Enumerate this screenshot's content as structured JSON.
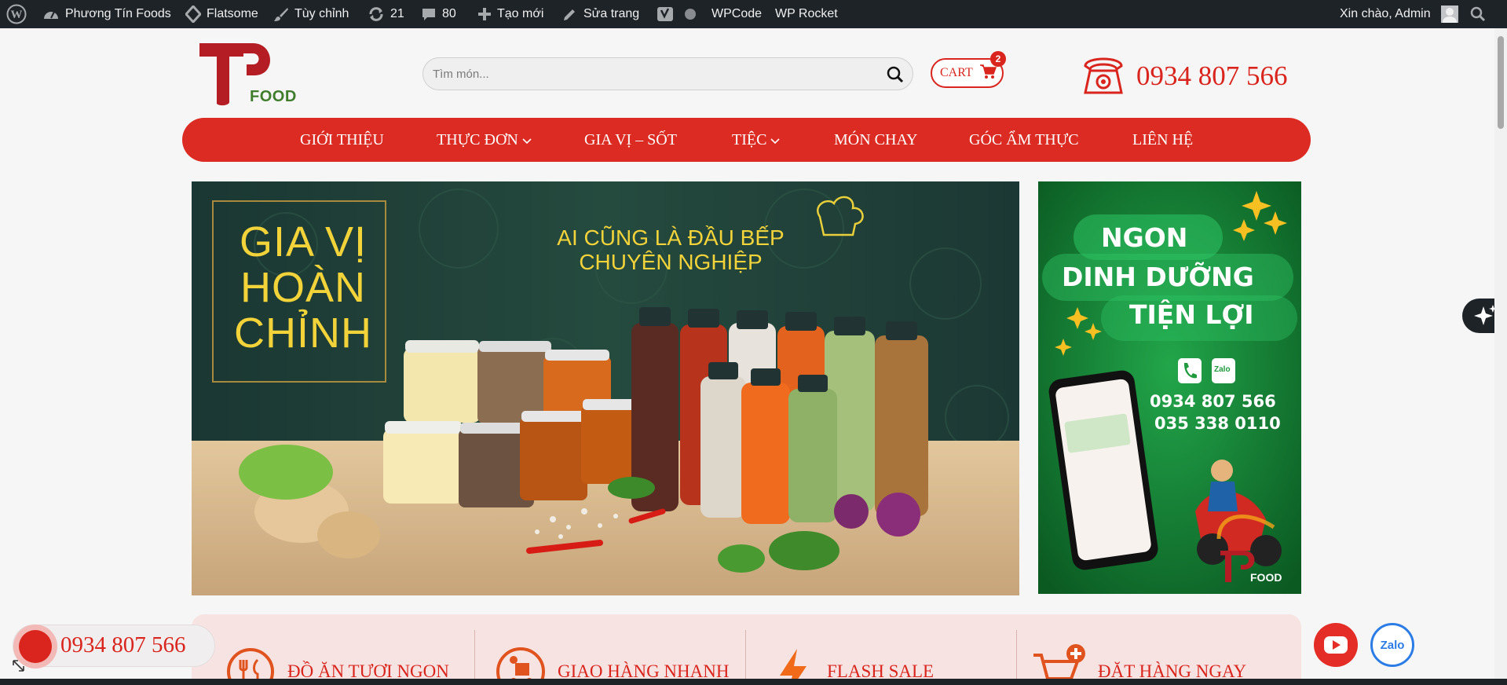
{
  "admin_bar": {
    "site_name": "Phương Tín Foods",
    "theme": "Flatsome",
    "customize": "Tùy chỉnh",
    "updates_count": "21",
    "comments_count": "80",
    "new_label": "Tạo mới",
    "edit_label": "Sửa trang",
    "wpcode": "WPCode",
    "wprocket": "WP Rocket",
    "greeting": "Xin chào, Admin"
  },
  "header": {
    "logo_text": "FOOD",
    "search_placeholder": "Tìm món...",
    "cart_label": "CART",
    "cart_count": "2",
    "phone": "0934 807 566"
  },
  "nav": {
    "items": [
      {
        "label": "GIỚI THIỆU"
      },
      {
        "label": "THỰC ĐƠN"
      },
      {
        "label": "GIA VỊ – SỐT"
      },
      {
        "label": "TIỆC"
      },
      {
        "label": "MÓN CHAY"
      },
      {
        "label": "GÓC ẨM THỰC"
      },
      {
        "label": "LIÊN HỆ"
      }
    ]
  },
  "main_banner": {
    "title_line1": "GIA VỊ",
    "title_line2": "HOÀN",
    "title_line3": "CHỈNH",
    "slogan_line1": "AI CŨNG LÀ ĐẦU BẾP",
    "slogan_line2": "CHUYÊN NGHIỆP"
  },
  "side_banner": {
    "line1": "NGON",
    "line2": "DINH DƯỠNG",
    "line3": "TIỆN LỢI",
    "zalo": "Zalo",
    "phone1": "0934 807 566",
    "phone2": "035 338 0110",
    "logo_text": "FOOD"
  },
  "features": [
    {
      "label": "ĐỒ ĂN TƯƠI NGON"
    },
    {
      "label": "GIAO HÀNG NHANH"
    },
    {
      "label": "FLASH SALE"
    },
    {
      "label": "ĐẶT HÀNG NGAY"
    }
  ],
  "floating": {
    "phone": "0934 807 566",
    "zalo": "Zalo"
  },
  "colors": {
    "brand_red": "#d9251d",
    "admin_bar": "#1d2327",
    "logo_green": "#3f7d2c"
  }
}
